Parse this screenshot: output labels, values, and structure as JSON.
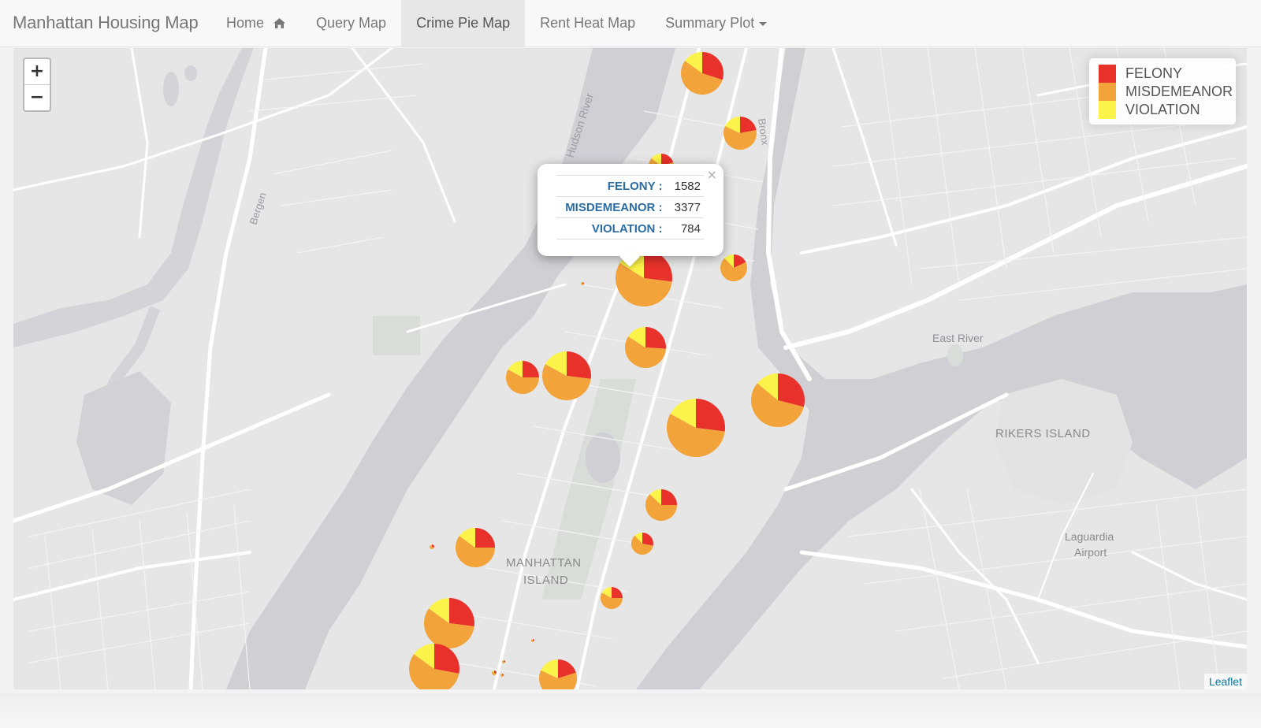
{
  "navbar": {
    "brand": "Manhattan Housing Map",
    "items": [
      {
        "label": "Home",
        "icon": "home-icon",
        "active": false
      },
      {
        "label": "Query Map",
        "active": false
      },
      {
        "label": "Crime Pie Map",
        "active": true
      },
      {
        "label": "Rent Heat Map",
        "active": false
      },
      {
        "label": "Summary Plot",
        "dropdown": true,
        "active": false
      }
    ]
  },
  "map": {
    "zoom_in": "+",
    "zoom_out": "−",
    "attribution": "Leaflet",
    "place_labels": {
      "hudson_river": "Hudson River",
      "east_river": "East River",
      "rikers_island": "RIKERS ISLAND",
      "laguardia_1": "Laguardia",
      "laguardia_2": "Airport",
      "manhattan_1": "MANHATTAN",
      "manhattan_2": "ISLAND",
      "bronx": "Bronx",
      "bergen": "Bergen"
    }
  },
  "legend": {
    "items": [
      {
        "label": "FELONY",
        "color": "#e8312a"
      },
      {
        "label": "MISDEMEANOR",
        "color": "#f2a33a"
      },
      {
        "label": "VIOLATION",
        "color": "#fcf34a"
      }
    ]
  },
  "popup": {
    "close": "×",
    "rows": [
      {
        "key": "FELONY :",
        "value": "1582"
      },
      {
        "key": "MISDEMEANOR :",
        "value": "3377"
      },
      {
        "key": "VIOLATION :",
        "value": "784"
      }
    ]
  }
}
